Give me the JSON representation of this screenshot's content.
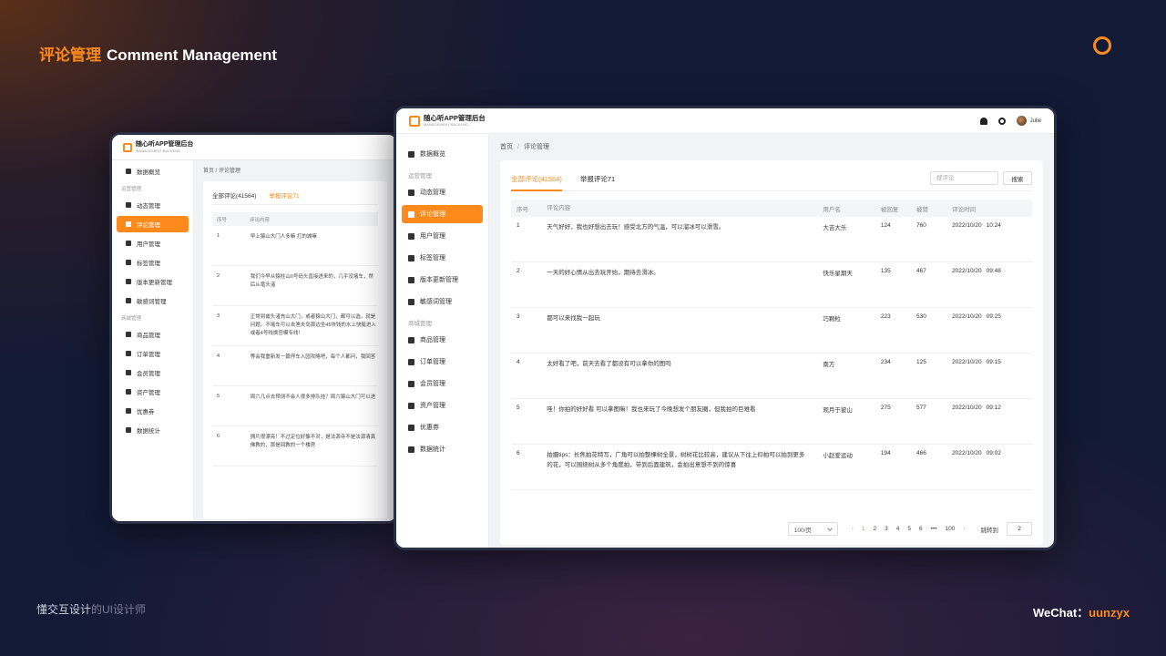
{
  "slide": {
    "title_zh": "评论管理",
    "title_en": "Comment Management",
    "footer_left_a": "懂交互设计",
    "footer_left_b": "的UI设计师",
    "footer_right_label": "WeChat：",
    "footer_right_handle": "uunzyx"
  },
  "app": {
    "logo_text": "随心听APP管理后台",
    "logo_sub": "MANAGEMENT BACKEND",
    "user_name": "Julie"
  },
  "sidebar": {
    "items_top": [
      {
        "label": "数据概览",
        "icon": "bar-chart-icon"
      }
    ],
    "group_ops": "运营管理",
    "items_ops": [
      {
        "label": "动态管理",
        "icon": "image-icon"
      },
      {
        "label": "评论管理",
        "icon": "comment-icon",
        "active": true
      },
      {
        "label": "用户管理",
        "icon": "user-icon"
      },
      {
        "label": "标签管理",
        "icon": "tag-icon"
      },
      {
        "label": "版本更新管理",
        "icon": "update-icon"
      },
      {
        "label": "敏感词管理",
        "icon": "warning-icon"
      }
    ],
    "group_shop": "商城管理",
    "items_shop": [
      {
        "label": "商品管理",
        "icon": "goods-icon"
      },
      {
        "label": "订单管理",
        "icon": "order-icon"
      },
      {
        "label": "会员管理",
        "icon": "member-icon"
      },
      {
        "label": "资产管理",
        "icon": "asset-icon"
      },
      {
        "label": "优惠券",
        "icon": "coupon-icon"
      },
      {
        "label": "数据统计",
        "icon": "stats-icon"
      }
    ]
  },
  "breadcrumb": {
    "home": "首页",
    "sep": "/",
    "current": "评论管理"
  },
  "tabs": {
    "all": "全部评论(41564)",
    "reported": "举报评论71"
  },
  "search": {
    "placeholder": "搜评论",
    "button": "搜索"
  },
  "table": {
    "headers": {
      "no": "序号",
      "content": "评论内容",
      "user": "用户名",
      "replies": "被回复",
      "likes": "被赞",
      "time": "评论时间"
    },
    "rows": [
      {
        "no": "1",
        "content": "天气好好，我也好想出去玩！感受北方的气温，可以溜冰可以滑雪。",
        "user": "大吉大乐",
        "replies": "124",
        "likes": "760",
        "date": "2022/10/20",
        "time": "10:24"
      },
      {
        "no": "2",
        "content": "一天的好心情从出去玩开始，期待去滑冰。",
        "user": "快乐星期天",
        "replies": "135",
        "likes": "467",
        "date": "2022/10/20",
        "time": "09:48"
      },
      {
        "no": "3",
        "content": "都可以来找我一起玩",
        "user": "巧颗粒",
        "replies": "223",
        "likes": "530",
        "date": "2022/10/20",
        "time": "09:25"
      },
      {
        "no": "4",
        "content": "太好看了吧，前天去看了都没有可以拿你的图吗",
        "user": "南方",
        "replies": "234",
        "likes": "125",
        "date": "2022/10/20",
        "time": "09:15"
      },
      {
        "no": "5",
        "content": "哇！你拍的好好看 可以拿图嘛！我也来玩了今晚想发个朋友圈，但我拍的巨难看",
        "user": "观月于彼山",
        "replies": "275",
        "likes": "577",
        "date": "2022/10/20",
        "time": "09:12"
      },
      {
        "no": "6",
        "content": "拍摄tips：长焦拍花特写，广角可以拍整棵树全景，树树花比较高，建议从下往上仰拍可以拍到更多的花，可以围绕树从多个角度拍，带到后面建筑，会拍出意想不到的惊喜",
        "user": "小赵爱运动",
        "replies": "194",
        "likes": "466",
        "date": "2022/10/20",
        "time": "09:02"
      }
    ]
  },
  "pagination": {
    "page_size": "100/页",
    "prev": "‹",
    "pages": [
      "1",
      "2",
      "3",
      "4",
      "5",
      "6",
      "•••",
      "100"
    ],
    "next": "›",
    "jump_label": "跳转到",
    "jump_value": "2"
  },
  "back_screen": {
    "rows": [
      {
        "no": "1",
        "content": "早上猿山大门人多嘛 打的城嘛"
      },
      {
        "no": "2",
        "content": "我们今早从猿柱山II号码头直接进来的，几乎没堵车，然后从竜头渚"
      },
      {
        "no": "3",
        "content": "正常到鼋头渚充山大门，或者猿山大门，都可以选，就是问题。不堵车可以去渔夫岛那边坐45块钱的水上快艇进入或者4号线换宫模专线！"
      },
      {
        "no": "4",
        "content": "等会我重新发一篇停车入园攻略吧，每个人都问，我回答"
      },
      {
        "no": "5",
        "content": "周六几点去预测不会人很多排队挂？周六猿山大门可以进"
      },
      {
        "no": "6",
        "content": "拥片很漂亮！不过定位好像不对，是法源寺不是法源清真佛教的，那是回教的一个楼房"
      }
    ]
  }
}
